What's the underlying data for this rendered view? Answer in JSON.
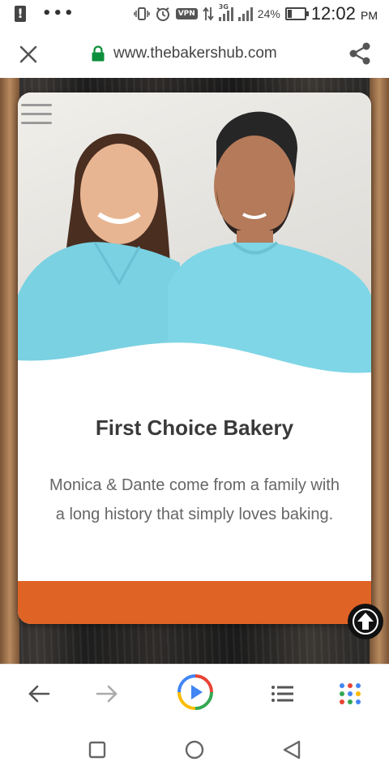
{
  "status_bar": {
    "alert": "!",
    "dots": "•••",
    "vpn": "VPN",
    "network": "3G",
    "battery_percent": "24%",
    "battery_level": 0.24,
    "time": "12:02",
    "ampm": "PM"
  },
  "url_bar": {
    "url": "www.thebakershub.com",
    "lock_color": "#0d8f3c"
  },
  "card": {
    "title": "First Choice Bakery",
    "description": "Monica & Dante come from a family with a long history that simply loves baking.",
    "accent_color": "#e06326"
  },
  "icons": {
    "close": "close-icon",
    "share": "share-icon",
    "menu": "hamburger-menu-icon",
    "back_to_top": "arrow-up-circle-icon",
    "back": "arrow-left-icon",
    "forward": "arrow-right-icon",
    "play": "play-circle-icon",
    "list": "list-icon",
    "apps": "apps-grid-icon"
  }
}
